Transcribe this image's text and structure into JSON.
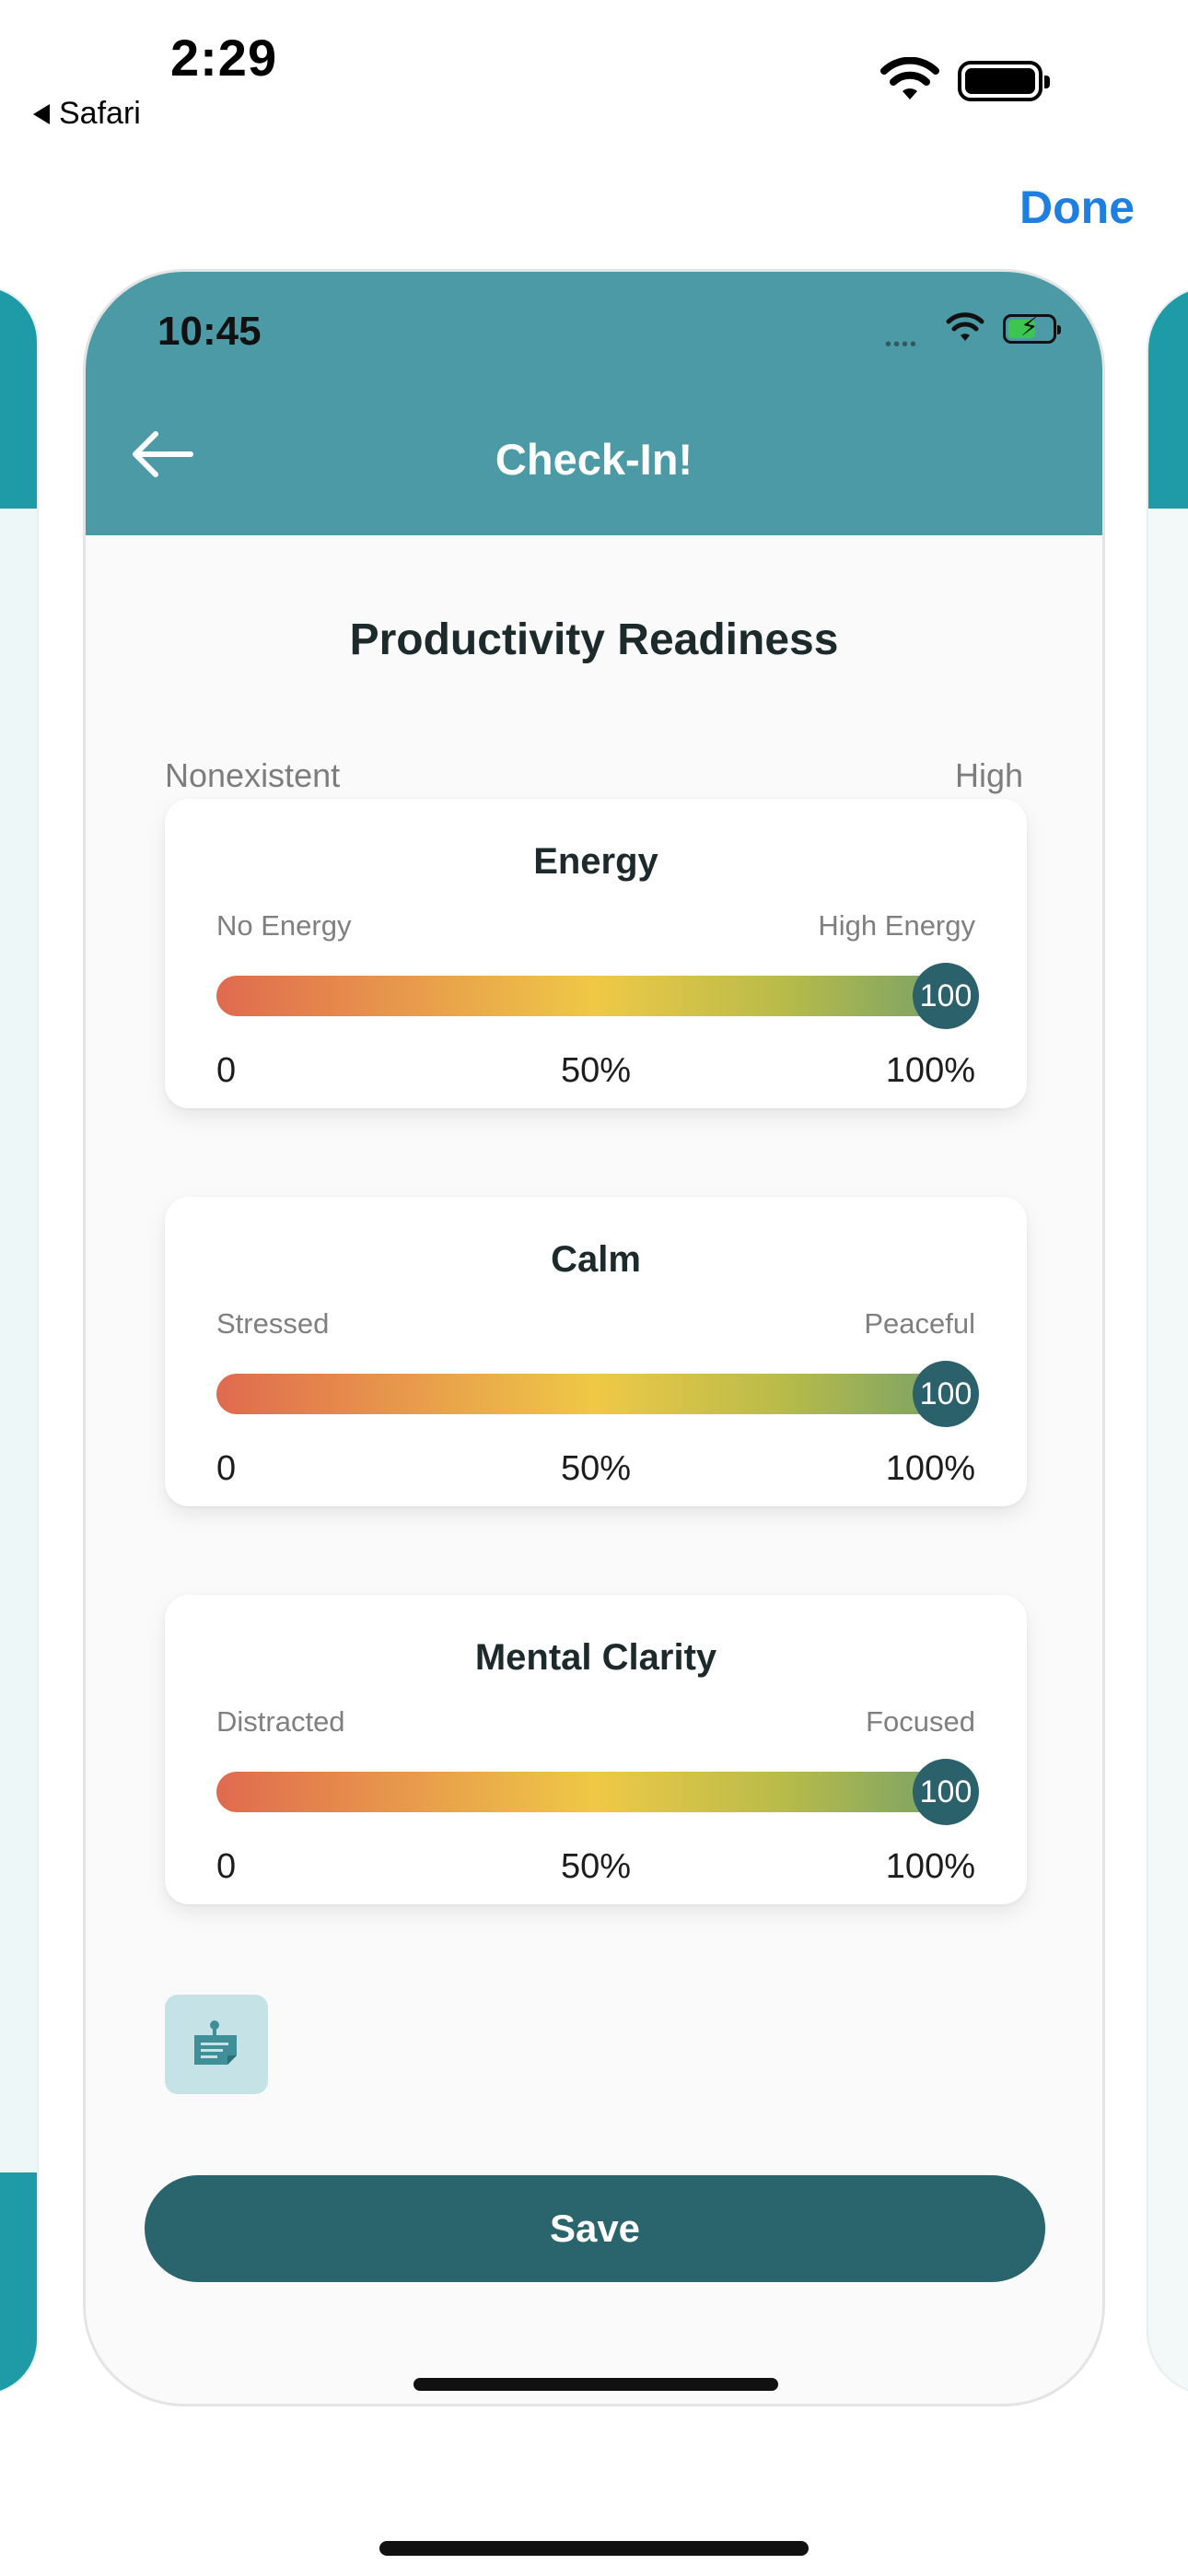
{
  "os": {
    "time": "2:29",
    "back_label": "Safari",
    "done_label": "Done"
  },
  "phone": {
    "status_time": "10:45",
    "header_title": "Check-In!",
    "page_title": "Productivity Readiness",
    "scale_low": "Nonexistent",
    "scale_high": "High",
    "sliders": [
      {
        "title": "Energy",
        "low_label": "No Energy",
        "high_label": "High Energy",
        "value": 100,
        "value_label": "100",
        "tick_min": "0",
        "tick_mid": "50%",
        "tick_max": "100%"
      },
      {
        "title": "Calm",
        "low_label": "Stressed",
        "high_label": "Peaceful",
        "value": 100,
        "value_label": "100",
        "tick_min": "0",
        "tick_mid": "50%",
        "tick_max": "100%"
      },
      {
        "title": "Mental Clarity",
        "low_label": "Distracted",
        "high_label": "Focused",
        "value": 100,
        "value_label": "100",
        "tick_min": "0",
        "tick_mid": "50%",
        "tick_max": "100%"
      }
    ],
    "note_icon": "note-icon",
    "save_label": "Save"
  },
  "colors": {
    "header": "#4b9aa5",
    "accent_dark": "#2a646c",
    "link": "#1f7fe0"
  }
}
